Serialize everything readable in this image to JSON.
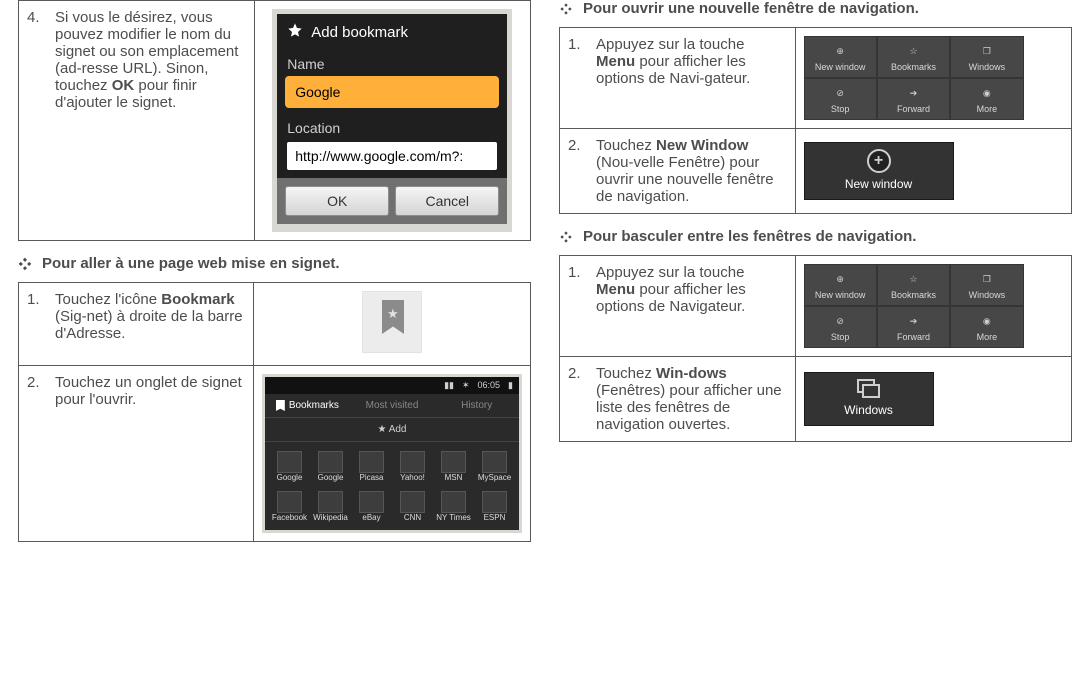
{
  "left": {
    "step4": {
      "num": "4.",
      "text_before_bold": "Si vous le désirez, vous pouvez modifier le nom du signet ou son emplacement (ad-resse URL). Sinon, touchez ",
      "bold": "OK",
      "text_after_bold": " pour finir d'ajouter le signet."
    },
    "addbm": {
      "title": "Add bookmark",
      "name_label": "Name",
      "name_value": "Google",
      "loc_label": "Location",
      "loc_value": "http://www.google.com/m?:",
      "ok": "OK",
      "cancel": "Cancel"
    },
    "heading1": "Pour aller à une page web mise en signet.",
    "s1": {
      "num": "1.",
      "pre": "Touchez l'icône ",
      "bold": "Bookmark",
      "post": " (Sig-net) à droite de la barre d'Adresse."
    },
    "s2": {
      "num": "2.",
      "text": "Touchez un onglet de signet pour l'ouvrir."
    },
    "bmgrid": {
      "time": "06:05",
      "tab1": "Bookmarks",
      "tab2": "Most visited",
      "tab3": "History",
      "add": "Add",
      "cells": [
        "Google",
        "Google",
        "Picasa",
        "Yahoo!",
        "MSN",
        "MySpace",
        "Facebook",
        "Wikipedia",
        "eBay",
        "CNN",
        "NY Times",
        "ESPN"
      ]
    }
  },
  "right": {
    "headingA": "Pour ouvrir une nouvelle fenêtre de navigation.",
    "a1": {
      "num": "1.",
      "pre": "Appuyez sur la touche ",
      "bold": "Menu",
      "post": " pour afficher les options de Navi-gateur."
    },
    "a2": {
      "num": "2.",
      "pre": "Touchez ",
      "bold": "New Window",
      "post": " (Nou-velle Fenêtre) pour ouvrir une nouvelle fenêtre de navigation."
    },
    "menu": {
      "m1": "New window",
      "m2": "Bookmarks",
      "m3": "Windows",
      "m4": "Stop",
      "m5": "Forward",
      "m6": "More"
    },
    "newwindow_label": "New window",
    "headingB": "Pour basculer entre les fenêtres de navigation.",
    "b1": {
      "num": "1.",
      "pre": "Appuyez sur la touche ",
      "bold": "Menu",
      "post": " pour afficher les options de Navigateur."
    },
    "b2": {
      "num": "2.",
      "pre": "Touchez ",
      "bold": "Win-dows",
      "post": " (Fenêtres) pour afficher une liste des fenêtres de navigation ouvertes."
    },
    "windows_label": "Windows"
  }
}
